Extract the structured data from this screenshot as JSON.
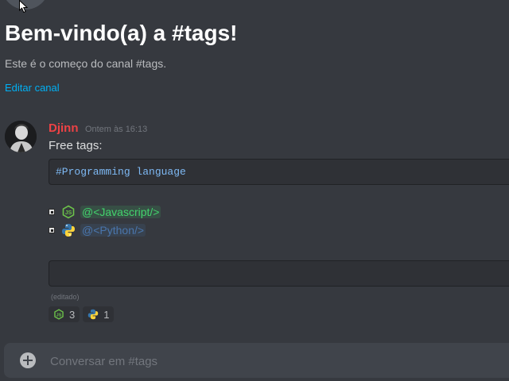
{
  "welcome": {
    "title": "Bem-vindo(a) a #tags!",
    "subtitle": "Este é o começo do canal #tags.",
    "edit_link": "Editar canal"
  },
  "message": {
    "author": "Djinn",
    "timestamp": "Ontem às 16:13",
    "text": "Free tags:",
    "code": "#Programming language",
    "tags": [
      {
        "icon": "nodejs-icon",
        "label": "@<Javascript/>",
        "color": "#43d36d"
      },
      {
        "icon": "python-icon",
        "label": "@<Python/>",
        "color": "#4a76ad"
      }
    ],
    "edited": "(editado)",
    "reactions": [
      {
        "icon": "nodejs-icon",
        "count": "3"
      },
      {
        "icon": "python-icon",
        "count": "1"
      }
    ]
  },
  "composer": {
    "placeholder": "Conversar em #tags"
  },
  "colors": {
    "background": "#36393f",
    "author": "#ed4245",
    "link": "#00b0f4",
    "code_text": "#7eb9f4"
  }
}
